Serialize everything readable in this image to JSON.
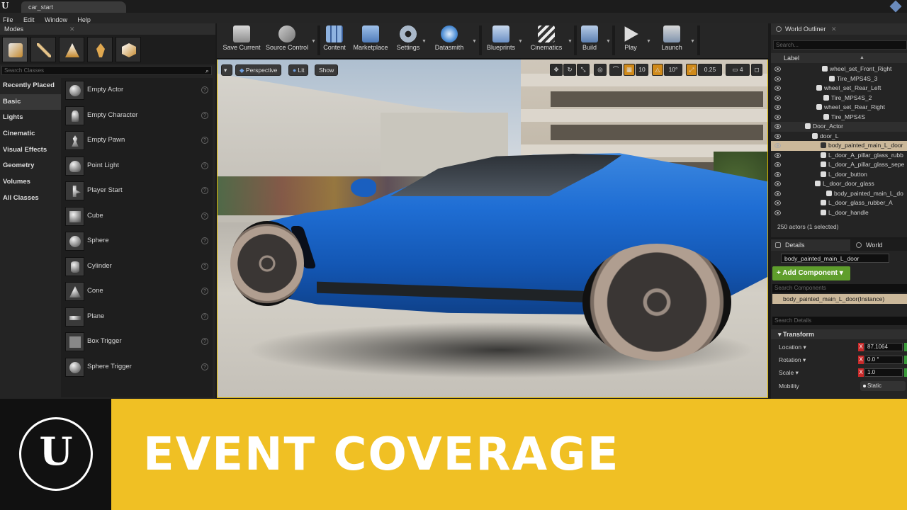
{
  "window": {
    "tab_title": "car_start"
  },
  "menu": [
    "File",
    "Edit",
    "Window",
    "Help"
  ],
  "modes": {
    "title": "Modes",
    "search_placeholder": "Search Classes",
    "categories": [
      "Recently Placed",
      "Basic",
      "Lights",
      "Cinematic",
      "Visual Effects",
      "Geometry",
      "Volumes",
      "All Classes"
    ],
    "selected_category": "Basic",
    "actors": [
      "Empty Actor",
      "Empty Character",
      "Empty Pawn",
      "Point Light",
      "Player Start",
      "Cube",
      "Sphere",
      "Cylinder",
      "Cone",
      "Plane",
      "Box Trigger",
      "Sphere Trigger"
    ]
  },
  "toolbar": {
    "buttons": [
      "Save Current",
      "Source Control",
      "Content",
      "Marketplace",
      "Settings",
      "Datasmith",
      "Blueprints",
      "Cinematics",
      "Build",
      "Play",
      "Launch"
    ]
  },
  "viewport": {
    "perspective": "Perspective",
    "lit": "Lit",
    "show": "Show",
    "grid_snap": "10",
    "rotation_snap": "10°",
    "scale_snap": "0.25",
    "camera_speed": "4"
  },
  "outliner": {
    "title": "World Outliner",
    "search_placeholder": "Search...",
    "label_header": "Label",
    "rows": [
      "wheel_set_Front_Right",
      "Tire_MPS4S_3",
      "wheel_set_Rear_Left",
      "Tire_MPS4S_2",
      "wheel_set_Rear_Right",
      "Tire_MPS4S",
      "Door_Actor",
      "door_L",
      "body_painted_main_L_door",
      "L_door_A_pillar_glass_rubb",
      "L_door_A_pillar_glass_sepe",
      "L_door_button",
      "L_door_door_glass",
      "body_painted_main_L_do",
      "L_door_glass_rubber_A",
      "L_door_handle"
    ],
    "actor_count": "250 actors (1 selected)"
  },
  "details": {
    "tab_details": "Details",
    "tab_world_settings": "World Settings",
    "object_name": "body_painted_main_L_door",
    "add_component": "+ Add Component ▾",
    "search_components": "Search Components",
    "instance": "body_painted_main_L_door(Instance)",
    "search_details": "Search Details",
    "section": "Transform",
    "location_label": "Location ▾",
    "location_x": "87.1064",
    "rotation_label": "Rotation ▾",
    "rotation_x": "0.0 °",
    "scale_label": "Scale ▾",
    "scale_x": "1.0",
    "mobility_label": "Mobility",
    "mobility_value": "Static"
  },
  "banner": {
    "text": "EVENT COVERAGE"
  },
  "colors": {
    "accent_yellow": "#f0c024",
    "selection": "#cbb89a",
    "add_green": "#5f9e2c"
  }
}
